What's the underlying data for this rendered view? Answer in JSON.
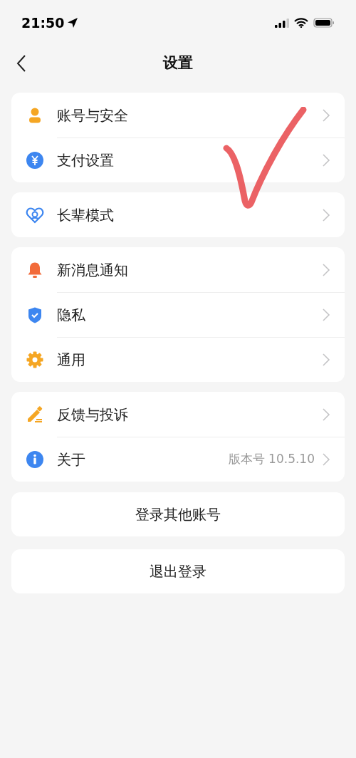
{
  "status_bar": {
    "time": "21:50"
  },
  "nav": {
    "title": "设置"
  },
  "groups": [
    {
      "rows": [
        {
          "label": "账号与安全"
        },
        {
          "label": "支付设置"
        }
      ]
    },
    {
      "rows": [
        {
          "label": "长辈模式"
        }
      ]
    },
    {
      "rows": [
        {
          "label": "新消息通知"
        },
        {
          "label": "隐私"
        },
        {
          "label": "通用"
        }
      ]
    },
    {
      "rows": [
        {
          "label": "反馈与投诉"
        },
        {
          "label": "关于",
          "value": "版本号 10.5.10"
        }
      ]
    }
  ],
  "buttons": [
    "登录其他账号",
    "退出登录"
  ]
}
